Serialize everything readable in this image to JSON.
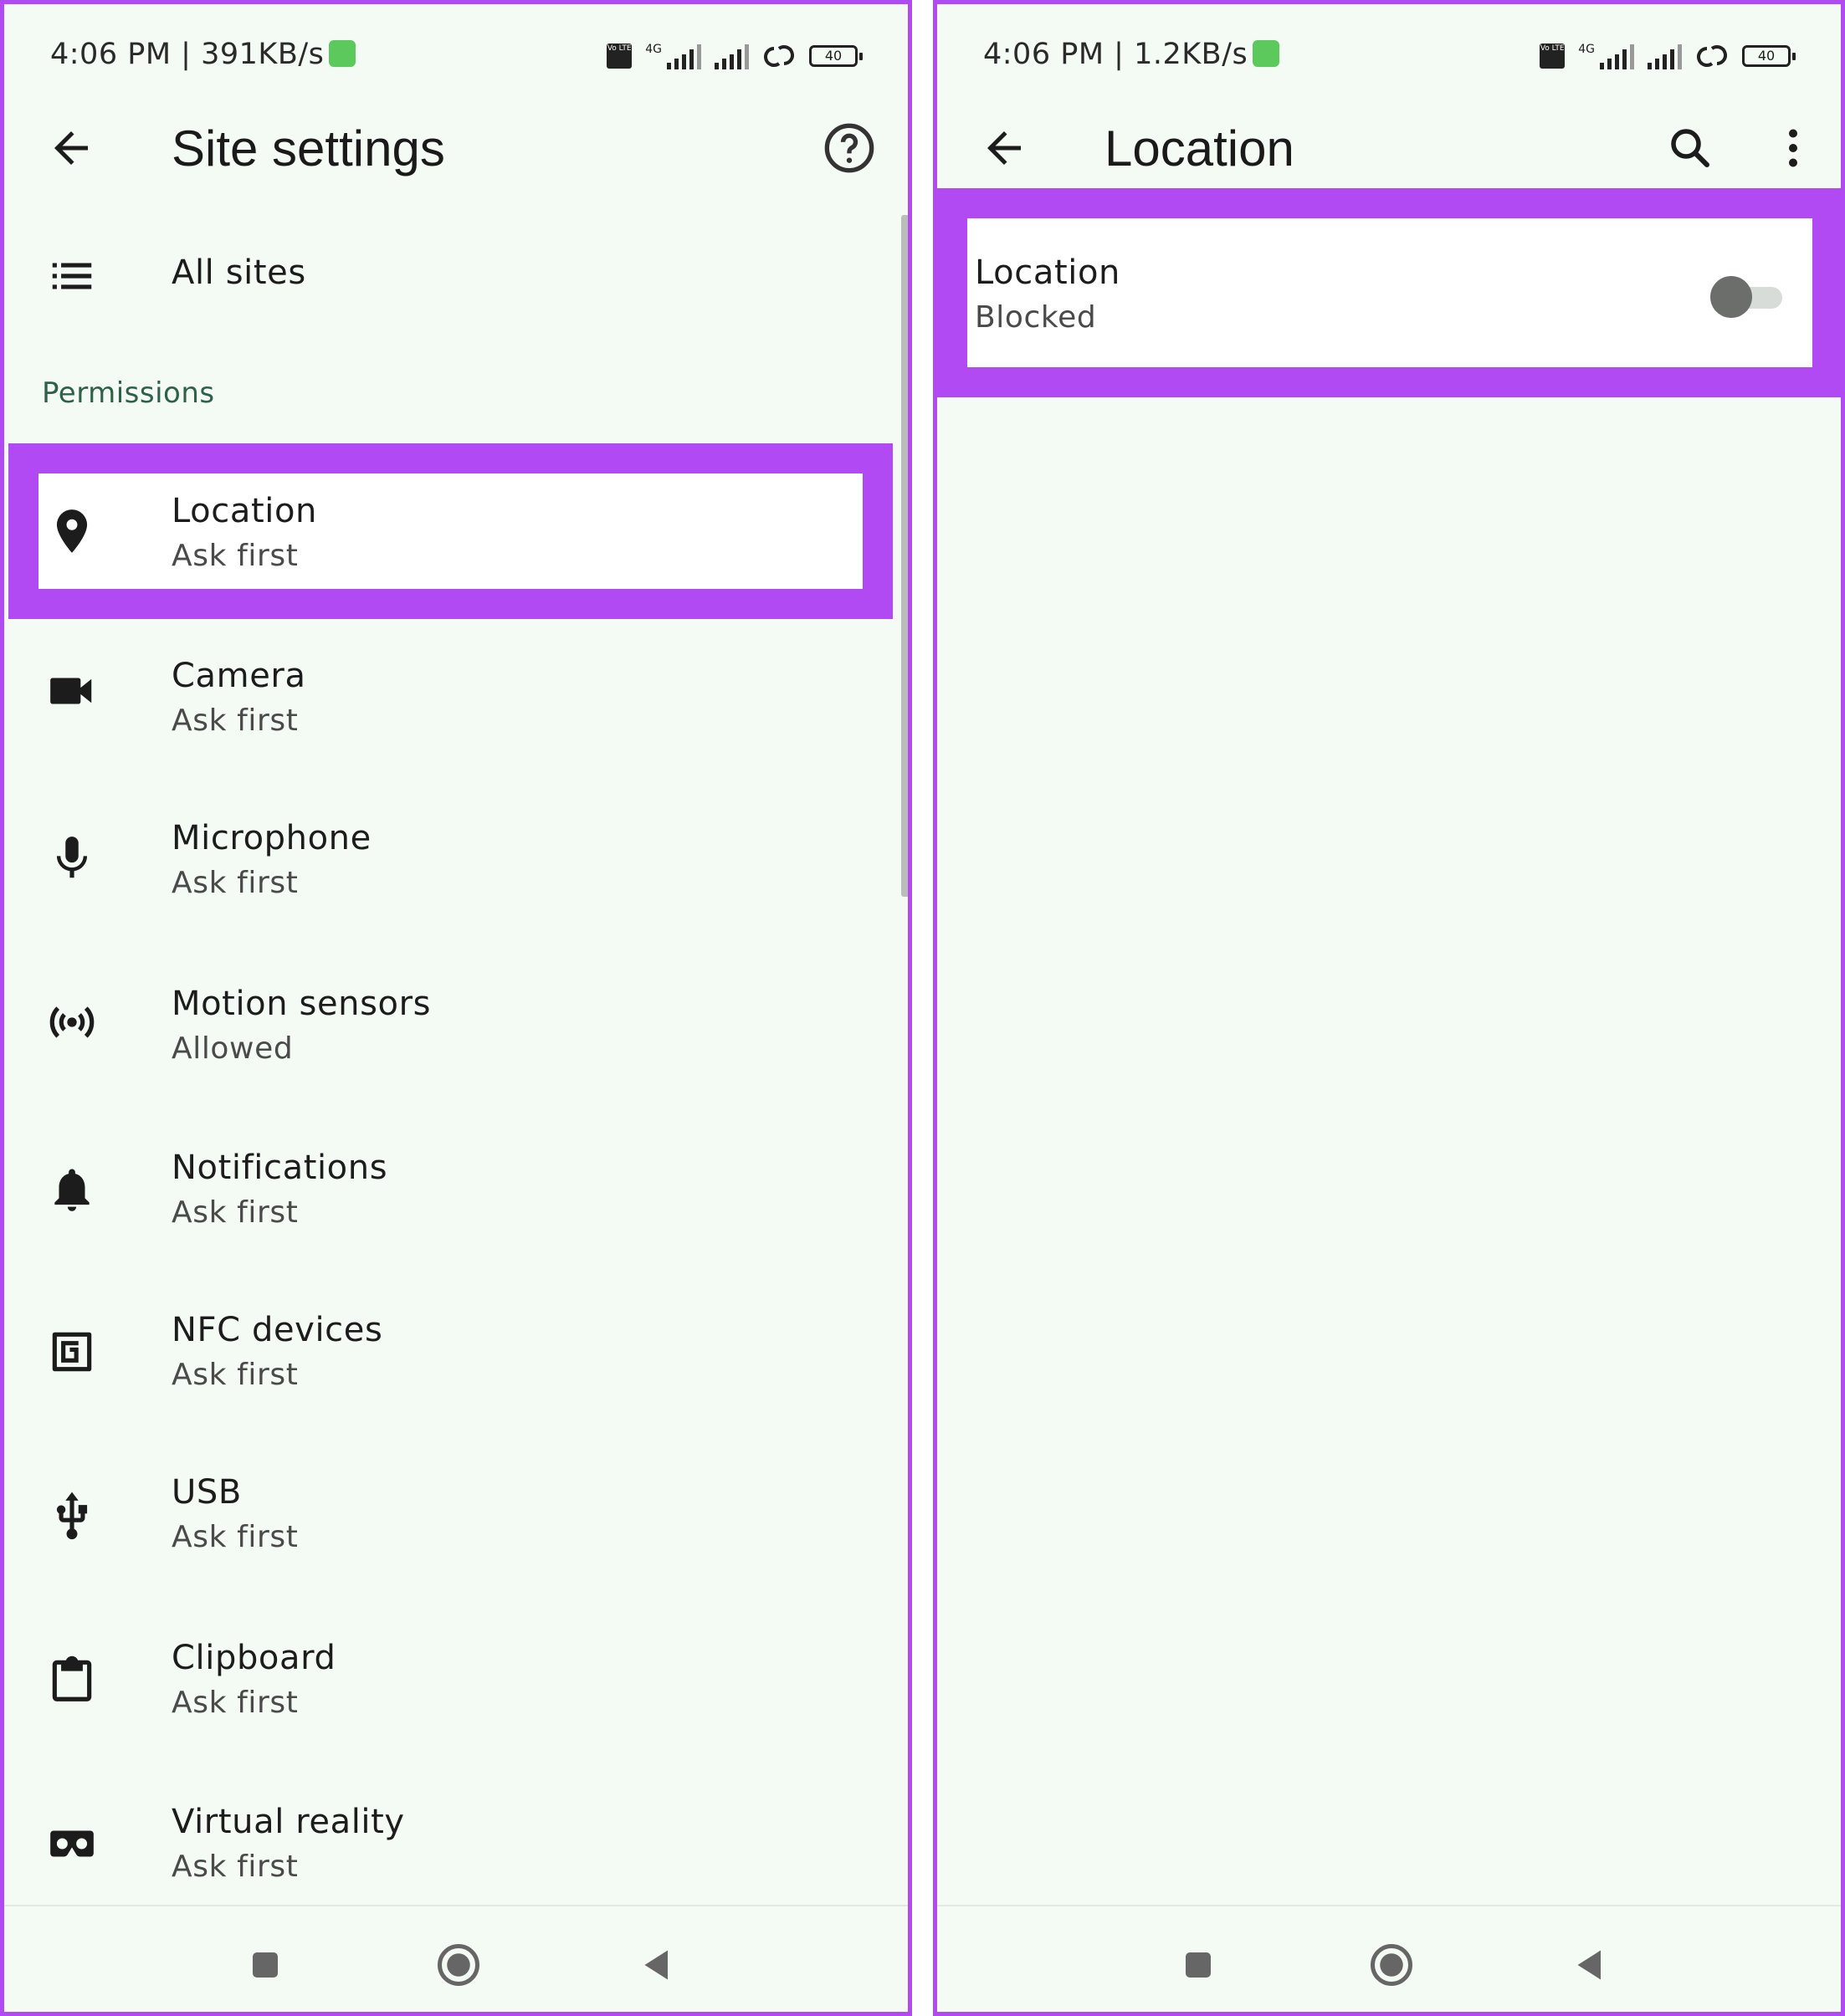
{
  "left": {
    "status": {
      "time": "4:06 PM | 391KB/s",
      "volte": "Vo LTE",
      "network": "4G",
      "battery": "40"
    },
    "appbar": {
      "title": "Site settings"
    },
    "all_sites": {
      "label": "All sites"
    },
    "section": "Permissions",
    "permissions": [
      {
        "label": "Location",
        "status": "Ask first",
        "icon": "location-pin-icon"
      },
      {
        "label": "Camera",
        "status": "Ask first",
        "icon": "camera-icon"
      },
      {
        "label": "Microphone",
        "status": "Ask first",
        "icon": "microphone-icon"
      },
      {
        "label": "Motion sensors",
        "status": "Allowed",
        "icon": "motion-sensors-icon"
      },
      {
        "label": "Notifications",
        "status": "Ask first",
        "icon": "bell-icon"
      },
      {
        "label": "NFC devices",
        "status": "Ask first",
        "icon": "nfc-icon"
      },
      {
        "label": "USB",
        "status": "Ask first",
        "icon": "usb-icon"
      },
      {
        "label": "Clipboard",
        "status": "Ask first",
        "icon": "clipboard-icon"
      },
      {
        "label": "Virtual reality",
        "status": "Ask first",
        "icon": "vr-headset-icon"
      }
    ]
  },
  "right": {
    "status": {
      "time": "4:06 PM | 1.2KB/s",
      "volte": "Vo LTE",
      "network": "4G",
      "battery": "40"
    },
    "appbar": {
      "title": "Location"
    },
    "setting": {
      "label": "Location",
      "status": "Blocked",
      "enabled": false
    }
  },
  "colors": {
    "highlight": "#b24af4",
    "background": "#f3fbf4",
    "section_text": "#2e6148"
  }
}
